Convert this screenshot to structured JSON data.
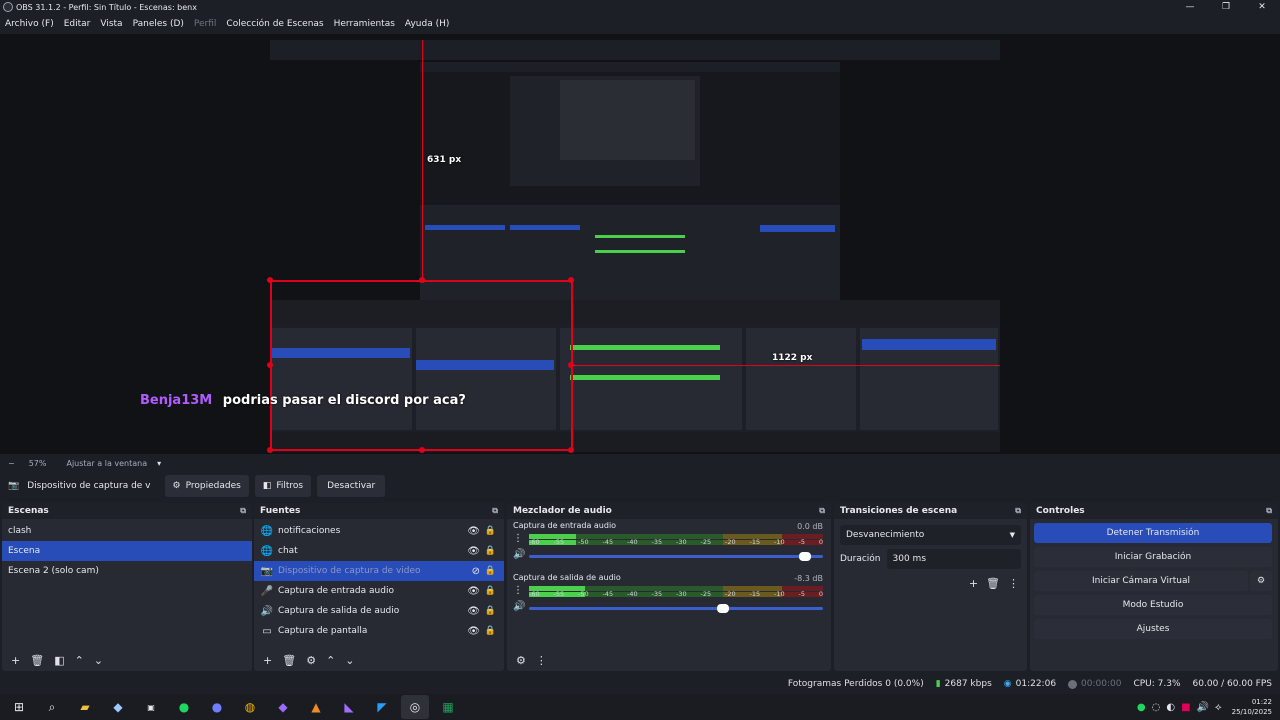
{
  "window": {
    "title": "OBS 31.1.2 - Perfil: Sin Título - Escenas: benx",
    "controls": {
      "minimize": "—",
      "maximize": "❐",
      "close": "✕"
    }
  },
  "menu": {
    "items": [
      "Archivo (F)",
      "Editar",
      "Vista",
      "Paneles (D)",
      "Perfil",
      "Colección de Escenas",
      "Herramientas",
      "Ayuda (H)"
    ],
    "disabled": [
      "Perfil"
    ]
  },
  "preview": {
    "chat_user": "Benja13M",
    "chat_message": "podrias pasar el discord por aca?",
    "guide_label_v": "631 px",
    "guide_label_h": "1122 px"
  },
  "zoom": {
    "minus": "−",
    "level": "57%",
    "fit_label": "Ajustar a la ventana",
    "dropdown": "▾"
  },
  "source_toolbar": {
    "device_name": "Dispositivo de captura de v",
    "properties": "Propiedades",
    "filters": "Filtros",
    "deactivate": "Desactivar"
  },
  "scenes": {
    "title": "Escenas",
    "items": [
      "clash",
      "Escena",
      "Escena 2 (solo cam)"
    ],
    "selected": "Escena"
  },
  "sources": {
    "title": "Fuentes",
    "items": [
      {
        "name": "notificaciones",
        "icon": "globe-icon"
      },
      {
        "name": "chat",
        "icon": "globe-icon"
      },
      {
        "name": "Dispositivo de captura de video",
        "icon": "camera-icon"
      },
      {
        "name": "Captura de entrada audio",
        "icon": "microphone-icon"
      },
      {
        "name": "Captura de salida de audio",
        "icon": "speaker-icon"
      },
      {
        "name": "Captura de pantalla",
        "icon": "monitor-icon"
      }
    ],
    "selected": "Dispositivo de captura de video"
  },
  "mixer": {
    "title": "Mezclador de audio",
    "scale": [
      "-60",
      "-55",
      "-50",
      "-45",
      "-40",
      "-35",
      "-30",
      "-25",
      "-20",
      "-15",
      "-10",
      "-5",
      "0"
    ],
    "channels": [
      {
        "name": "Captura de entrada audio",
        "db": "0.0 dB",
        "level": 0.16,
        "volume": 0.96
      },
      {
        "name": "Captura de salida de audio",
        "db": "-8.3 dB",
        "level": 0.19,
        "volume": 0.68
      }
    ]
  },
  "transitions": {
    "title": "Transiciones de escena",
    "selected": "Desvanecimiento",
    "duration_label": "Duración",
    "duration_value": "300 ms"
  },
  "controls": {
    "title": "Controles",
    "stop_stream": "Detener Transmisión",
    "start_recording": "Iniciar Grabación",
    "start_virtual_cam": "Iniciar Cámara Virtual",
    "studio_mode": "Modo Estudio",
    "settings": "Ajustes"
  },
  "status": {
    "dropped_frames": "Fotogramas Perdidos 0 (0.0%)",
    "bitrate": "2687 kbps",
    "stream_time": "01:22:06",
    "record_time": "00:00:00",
    "cpu": "CPU: 7.3%",
    "fps": "60.00 / 60.00 FPS",
    "colors": {
      "stream": "#3fa9f5",
      "bitrate": "#4ad04a",
      "record": "#6b6f78"
    }
  },
  "taskbar": {
    "icons": [
      "windows-start-icon",
      "search-icon",
      "file-explorer-icon",
      "steam-icon",
      "epic-games-icon",
      "spotify-icon",
      "discord-icon",
      "chrome-icon",
      "app-icon",
      "fl-studio-icon",
      "visual-studio-icon",
      "vscode-icon",
      "obs-icon",
      "spreadsheet-icon"
    ],
    "clock_time": "01:22",
    "clock_date": "25/10/2025"
  }
}
